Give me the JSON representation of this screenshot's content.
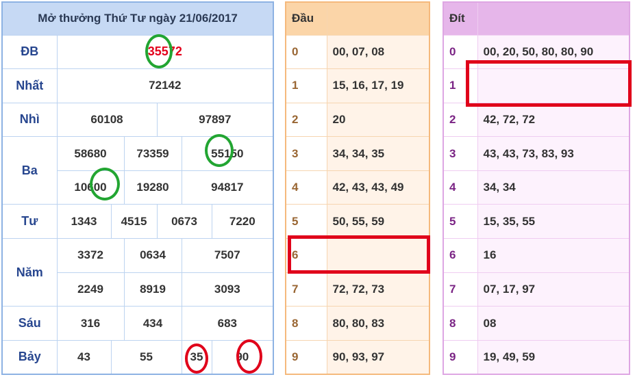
{
  "title": "Mở thưởng Thứ Tư ngày 21/06/2017",
  "rows": {
    "db": {
      "label": "ĐB",
      "value_prefix": "3",
      "value_highlight": "55",
      "value_suffix": "72"
    },
    "nhat": {
      "label": "Nhất",
      "values": [
        "72142"
      ]
    },
    "nhi": {
      "label": "Nhì",
      "values": [
        "60108",
        "97897"
      ]
    },
    "ba": {
      "label": "Ba",
      "values": [
        "58680",
        "73359",
        "55150",
        "10600",
        "19280",
        "94817"
      ]
    },
    "tu": {
      "label": "Tư",
      "values": [
        "1343",
        "4515",
        "0673",
        "7220"
      ]
    },
    "nam": {
      "label": "Năm",
      "values": [
        "3372",
        "0634",
        "7507",
        "2249",
        "8919",
        "3093"
      ]
    },
    "sau": {
      "label": "Sáu",
      "values": [
        "316",
        "434",
        "683"
      ]
    },
    "bay": {
      "label": "Bảy",
      "values": [
        "43",
        "55",
        "35",
        "90"
      ]
    }
  },
  "dau": {
    "header": "Đầu",
    "rows": [
      {
        "k": "0",
        "v": "00, 07, 08"
      },
      {
        "k": "1",
        "v": "15, 16, 17, 19"
      },
      {
        "k": "2",
        "v": "20"
      },
      {
        "k": "3",
        "v": "34, 34, 35"
      },
      {
        "k": "4",
        "v": "42, 43, 43, 49"
      },
      {
        "k": "5",
        "v": "50, 55, 59"
      },
      {
        "k": "6",
        "v": ""
      },
      {
        "k": "7",
        "v": "72, 72, 73"
      },
      {
        "k": "8",
        "v": "80, 80, 83"
      },
      {
        "k": "9",
        "v": "90, 93, 97"
      }
    ]
  },
  "dit": {
    "header": "Đít",
    "rows": [
      {
        "k": "0",
        "v": "00, 20, 50, 80, 80, 90"
      },
      {
        "k": "1",
        "v": ""
      },
      {
        "k": "2",
        "v": "42, 72, 72"
      },
      {
        "k": "3",
        "v": "43, 43, 73, 83, 93"
      },
      {
        "k": "4",
        "v": "34, 34"
      },
      {
        "k": "5",
        "v": "15, 35, 55"
      },
      {
        "k": "6",
        "v": "16"
      },
      {
        "k": "7",
        "v": "07, 17, 97"
      },
      {
        "k": "8",
        "v": "08"
      },
      {
        "k": "9",
        "v": "19, 49, 59"
      }
    ]
  },
  "colors": {
    "highlight_red": "#e3001b",
    "ring_green": "#22a532",
    "ring_red": "#e0001a"
  }
}
